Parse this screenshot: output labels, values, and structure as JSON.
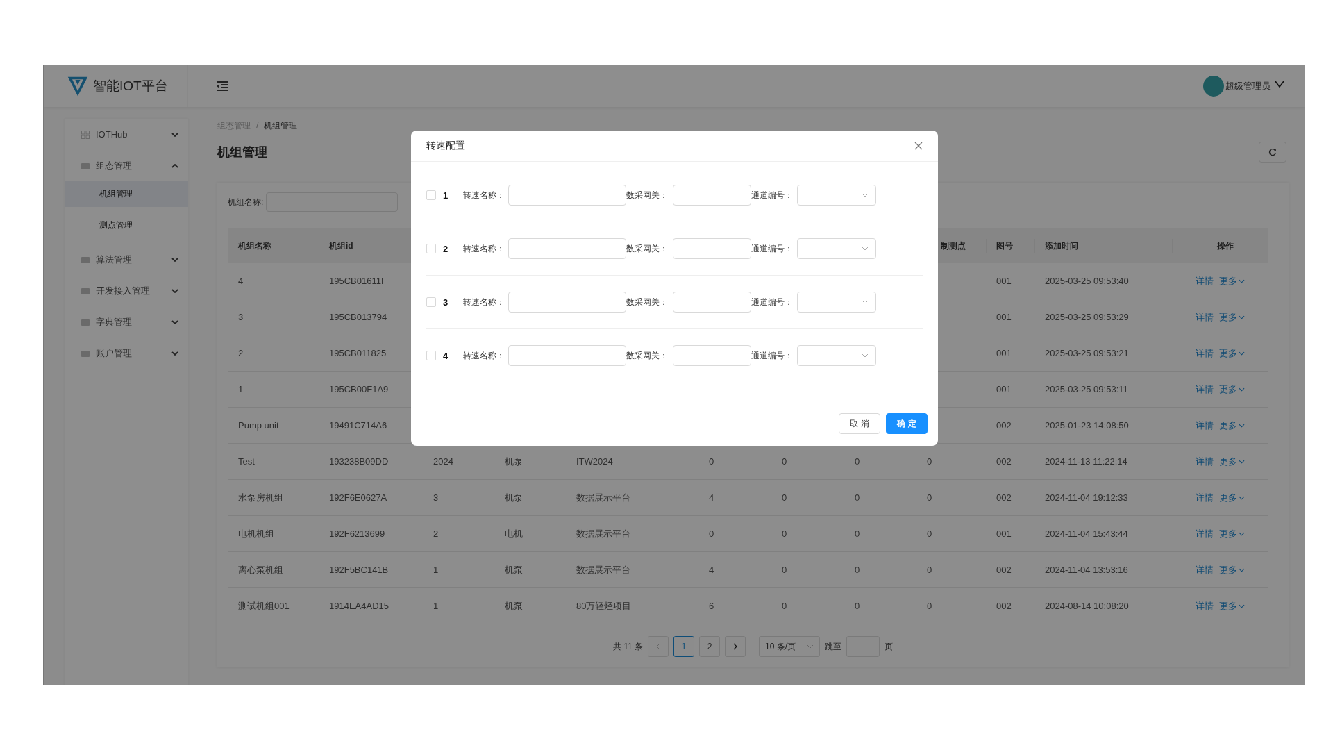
{
  "brand": {
    "name": "智能IOT平台"
  },
  "user": {
    "name": "超级管理员"
  },
  "sidebar": {
    "items": [
      {
        "label": "IOTHub",
        "expanded": false
      },
      {
        "label": "组态管理",
        "expanded": true,
        "children": [
          {
            "label": "机组管理",
            "selected": true
          },
          {
            "label": "测点管理",
            "selected": false
          }
        ]
      },
      {
        "label": "算法管理",
        "expanded": false
      },
      {
        "label": "开发接入管理",
        "expanded": false
      },
      {
        "label": "字典管理",
        "expanded": false
      },
      {
        "label": "账户管理",
        "expanded": false
      }
    ]
  },
  "breadcrumb": {
    "items": [
      "组态管理",
      "机组管理"
    ],
    "separator": "/"
  },
  "page_title": "机组管理",
  "filter": {
    "label": "机组名称:"
  },
  "table": {
    "columns": [
      "机组名称",
      "机组id",
      "",
      "",
      "",
      "",
      "",
      "",
      "制测点",
      "图号",
      "添加时间",
      "操作"
    ],
    "rows": [
      {
        "cells": [
          "4",
          "195CB01611F",
          null,
          null,
          null,
          null,
          null,
          null,
          null,
          "001",
          "2025-03-25 09:53:40"
        ],
        "actions": [
          "详情",
          "更多"
        ]
      },
      {
        "cells": [
          "3",
          "195CB013794",
          null,
          null,
          null,
          null,
          null,
          null,
          null,
          "001",
          "2025-03-25 09:53:29"
        ],
        "actions": [
          "详情",
          "更多"
        ]
      },
      {
        "cells": [
          "2",
          "195CB011825",
          null,
          null,
          null,
          null,
          null,
          null,
          null,
          "001",
          "2025-03-25 09:53:21"
        ],
        "actions": [
          "详情",
          "更多"
        ]
      },
      {
        "cells": [
          "1",
          "195CB00F1A9",
          null,
          null,
          null,
          null,
          null,
          null,
          null,
          "001",
          "2025-03-25 09:53:11"
        ],
        "actions": [
          "详情",
          "更多"
        ]
      },
      {
        "cells": [
          "Pump unit",
          "19491C714A6",
          null,
          null,
          null,
          null,
          null,
          null,
          null,
          "002",
          "2025-01-23 14:08:50"
        ],
        "actions": [
          "详情",
          "更多"
        ]
      },
      {
        "cells": [
          "Test",
          "193238B09DD",
          "2024",
          "机泵",
          "ITW2024",
          "0",
          "0",
          "0",
          "0",
          "002",
          "2024-11-13 11:22:14"
        ],
        "actions": [
          "详情",
          "更多"
        ]
      },
      {
        "cells": [
          "水泵房机组",
          "192F6E0627A",
          "3",
          "机泵",
          "数据展示平台",
          "4",
          "0",
          "0",
          "0",
          "002",
          "2024-11-04 19:12:33"
        ],
        "actions": [
          "详情",
          "更多"
        ]
      },
      {
        "cells": [
          "电机机组",
          "192F6213699",
          "2",
          "电机",
          "数据展示平台",
          "0",
          "0",
          "0",
          "0",
          "001",
          "2024-11-04 15:43:44"
        ],
        "actions": [
          "详情",
          "更多"
        ]
      },
      {
        "cells": [
          "离心泵机组",
          "192F5BC141B",
          "1",
          "机泵",
          "数据展示平台",
          "4",
          "0",
          "0",
          "0",
          "002",
          "2024-11-04 13:53:16"
        ],
        "actions": [
          "详情",
          "更多"
        ]
      },
      {
        "cells": [
          "测试机组001",
          "1914EA4AD15",
          "1",
          "机泵",
          "80万轻烃项目",
          "6",
          "0",
          "0",
          "0",
          "002",
          "2024-08-14 10:08:20"
        ],
        "actions": [
          "详情",
          "更多"
        ]
      }
    ]
  },
  "pagination": {
    "total": "共 11 条",
    "pages": [
      {
        "label": "1",
        "selected": true
      },
      {
        "label": "2",
        "selected": false
      }
    ],
    "page_size": "10 条/页",
    "jump_label": "跳至",
    "jump_suffix": "页"
  },
  "dialog": {
    "title": "转速配置",
    "rows": [
      {
        "index": "1",
        "checked": false,
        "fields": [
          {
            "label": "转速名称：",
            "kind": "input"
          },
          {
            "label": "数采网关：",
            "kind": "input"
          },
          {
            "label": "通道编号：",
            "kind": "select"
          }
        ]
      },
      {
        "index": "2",
        "checked": false,
        "fields": [
          {
            "label": "转速名称：",
            "kind": "input"
          },
          {
            "label": "数采网关：",
            "kind": "input"
          },
          {
            "label": "通道编号：",
            "kind": "select"
          }
        ]
      },
      {
        "index": "3",
        "checked": false,
        "fields": [
          {
            "label": "转速名称：",
            "kind": "input"
          },
          {
            "label": "数采网关：",
            "kind": "input"
          },
          {
            "label": "通道编号：",
            "kind": "select"
          }
        ]
      },
      {
        "index": "4",
        "checked": false,
        "fields": [
          {
            "label": "转速名称：",
            "kind": "input"
          },
          {
            "label": "数采网关：",
            "kind": "input"
          },
          {
            "label": "通道编号：",
            "kind": "select"
          }
        ]
      }
    ],
    "buttons": [
      {
        "label": "取 消",
        "kind": "default"
      },
      {
        "label": "确 定",
        "kind": "primary"
      }
    ]
  }
}
